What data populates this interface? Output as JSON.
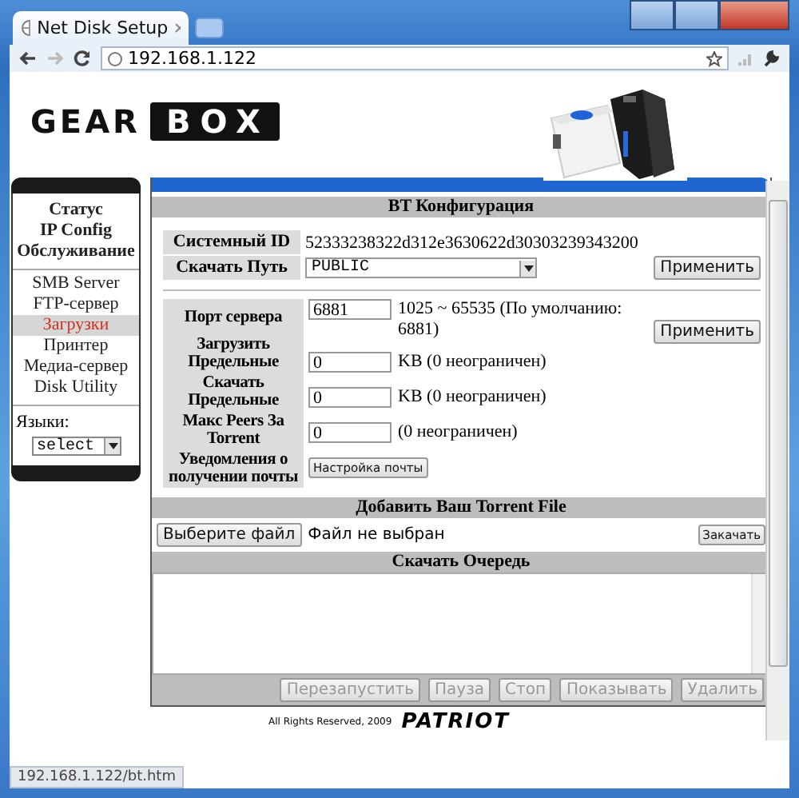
{
  "browser": {
    "tab_title": "Net Disk Setup",
    "address": "192.168.1.122"
  },
  "logo": {
    "left": "GEAR",
    "right": "BOX"
  },
  "sidebar": {
    "main_items": [
      {
        "label": "Статус",
        "selected": false
      },
      {
        "label": "IP Config",
        "selected": false
      },
      {
        "label": "Обслуживание",
        "selected": false
      }
    ],
    "items": [
      {
        "label": "SMB Server",
        "selected": false
      },
      {
        "label": "FTP-сервер",
        "selected": false
      },
      {
        "label": "Загрузки",
        "selected": true
      },
      {
        "label": "Принтер",
        "selected": false
      },
      {
        "label": "Медиа-сервер",
        "selected": false
      },
      {
        "label": "Disk Utility",
        "selected": false
      }
    ],
    "language_label": "Языки:",
    "language_select": "select"
  },
  "bt_config": {
    "title": "BT Конфигурация",
    "system_id_label": "Системный ID",
    "system_id": "52333238322d312e3630622d30303239343200",
    "path_label": "Скачать Путь",
    "path": "PUBLIC",
    "apply": "Применить",
    "apply_2": "Применить",
    "settings": [
      {
        "kind": "input",
        "label": "Порт сервера",
        "value": "6881",
        "note": "1025 ~ 65535 (По умолчанию: 6881)"
      },
      {
        "kind": "input",
        "label": "Загрузить Предельные",
        "value": "0",
        "note": "KB (0 неограничен)"
      },
      {
        "kind": "input",
        "label": "Скачать Предельные",
        "value": "0",
        "note": "KB (0 неограничен)"
      },
      {
        "kind": "input",
        "label": "Макс Peers За Torrent",
        "value": "0",
        "note": "(0 неограничен)"
      },
      {
        "kind": "button",
        "label": "Уведомления о получении почты",
        "button": "Настройка почты"
      }
    ]
  },
  "torrent_upload": {
    "title": "Добавить Ваш Torrent File",
    "choose": "Выберите файл",
    "file_status": "Файл не выбран",
    "upload": "Закачать"
  },
  "queue": {
    "title": "Скачать Очередь",
    "buttons": [
      {
        "label": "Перезапустить",
        "disabled": true
      },
      {
        "label": "Пауза",
        "disabled": true
      },
      {
        "label": "Стоп",
        "disabled": true
      },
      {
        "label": "Показывать",
        "disabled": true
      },
      {
        "label": "Удалить",
        "disabled": true
      }
    ]
  },
  "footer": {
    "copyright": "All Rights Reserved, 2009",
    "brand": "PATRIOT"
  },
  "status_bar": "192.168.1.122/bt.htm"
}
